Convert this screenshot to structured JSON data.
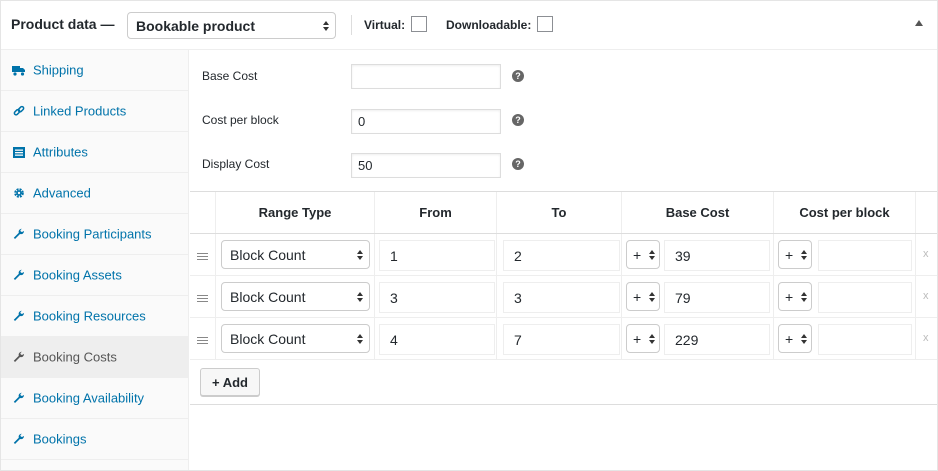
{
  "header": {
    "title": "Product data —",
    "product_type": "Bookable product",
    "virtual_label": "Virtual:",
    "downloadable_label": "Downloadable:"
  },
  "sidebar": {
    "items": [
      {
        "label": "Shipping",
        "icon": "truck-icon",
        "active": false
      },
      {
        "label": "Linked Products",
        "icon": "link-icon",
        "active": false
      },
      {
        "label": "Attributes",
        "icon": "list-icon",
        "active": false
      },
      {
        "label": "Advanced",
        "icon": "gear-icon",
        "active": false
      },
      {
        "label": "Booking Participants",
        "icon": "wrench-icon",
        "active": false
      },
      {
        "label": "Booking Assets",
        "icon": "wrench-icon",
        "active": false
      },
      {
        "label": "Booking Resources",
        "icon": "wrench-icon",
        "active": false
      },
      {
        "label": "Booking Costs",
        "icon": "wrench-icon",
        "active": true
      },
      {
        "label": "Booking Availability",
        "icon": "wrench-icon",
        "active": false
      },
      {
        "label": "Bookings",
        "icon": "wrench-icon",
        "active": false
      }
    ]
  },
  "fields": {
    "base_cost": {
      "label": "Base Cost",
      "value": ""
    },
    "cost_per_block": {
      "label": "Cost per block",
      "value": "0"
    },
    "display_cost": {
      "label": "Display Cost",
      "value": "50"
    },
    "help_glyph": "?"
  },
  "table": {
    "headers": [
      "Range Type",
      "From",
      "To",
      "Base Cost",
      "Cost per block"
    ],
    "rows": [
      {
        "range_type": "Block Count",
        "from": "1",
        "to": "2",
        "base_modifier": "+",
        "base_cost": "39",
        "block_modifier": "+",
        "block_cost": "",
        "remove": "x"
      },
      {
        "range_type": "Block Count",
        "from": "3",
        "to": "3",
        "base_modifier": "+",
        "base_cost": "79",
        "block_modifier": "+",
        "block_cost": "",
        "remove": "x"
      },
      {
        "range_type": "Block Count",
        "from": "4",
        "to": "7",
        "base_modifier": "+",
        "base_cost": "229",
        "block_modifier": "+",
        "block_cost": "",
        "remove": "x"
      }
    ],
    "add_label": "+ Add"
  },
  "colors": {
    "link": "#0073aa",
    "active_bg": "#eeeeee",
    "sidebar_bg": "#fafafa"
  }
}
